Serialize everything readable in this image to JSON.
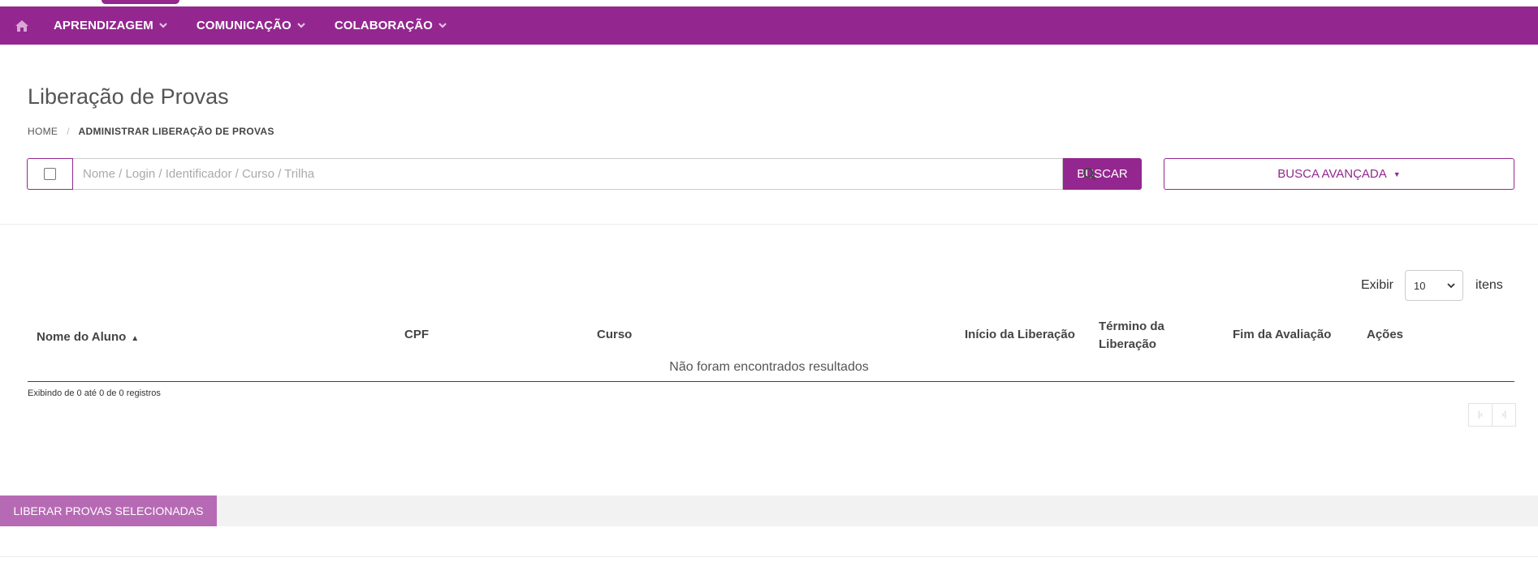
{
  "nav": {
    "items": [
      {
        "label": "APRENDIZAGEM"
      },
      {
        "label": "COMUNICAÇÃO"
      },
      {
        "label": "COLABORAÇÃO"
      }
    ]
  },
  "page": {
    "title": "Liberação de Provas",
    "breadcrumb": {
      "home": "HOME",
      "separator": "/",
      "current": "ADMINISTRAR LIBERAÇÃO DE PROVAS"
    }
  },
  "search": {
    "placeholder": "Nome / Login / Identificador / Curso / Trilha",
    "value": "",
    "button_label": "BUSCAR",
    "advanced_label": "BUSCA AVANÇADA"
  },
  "table": {
    "show_label": "Exibir",
    "page_size": "10",
    "items_label": "itens",
    "columns": {
      "nome": "Nome do Aluno",
      "cpf": "CPF",
      "curso": "Curso",
      "inicio": "Início da Liberação",
      "termino_1": "Término da",
      "termino_2": "Liberação",
      "fim": "Fim da Avaliação",
      "acoes": "Ações"
    },
    "empty_message": "Não foram encontrados resultados",
    "info": "Exibindo de 0 até 0 de 0 registros"
  },
  "actions": {
    "release_label": "LIBERAR PROVAS SELECIONADAS"
  },
  "colors": {
    "brand": "#93278f",
    "release_button": "#b76ab4"
  }
}
